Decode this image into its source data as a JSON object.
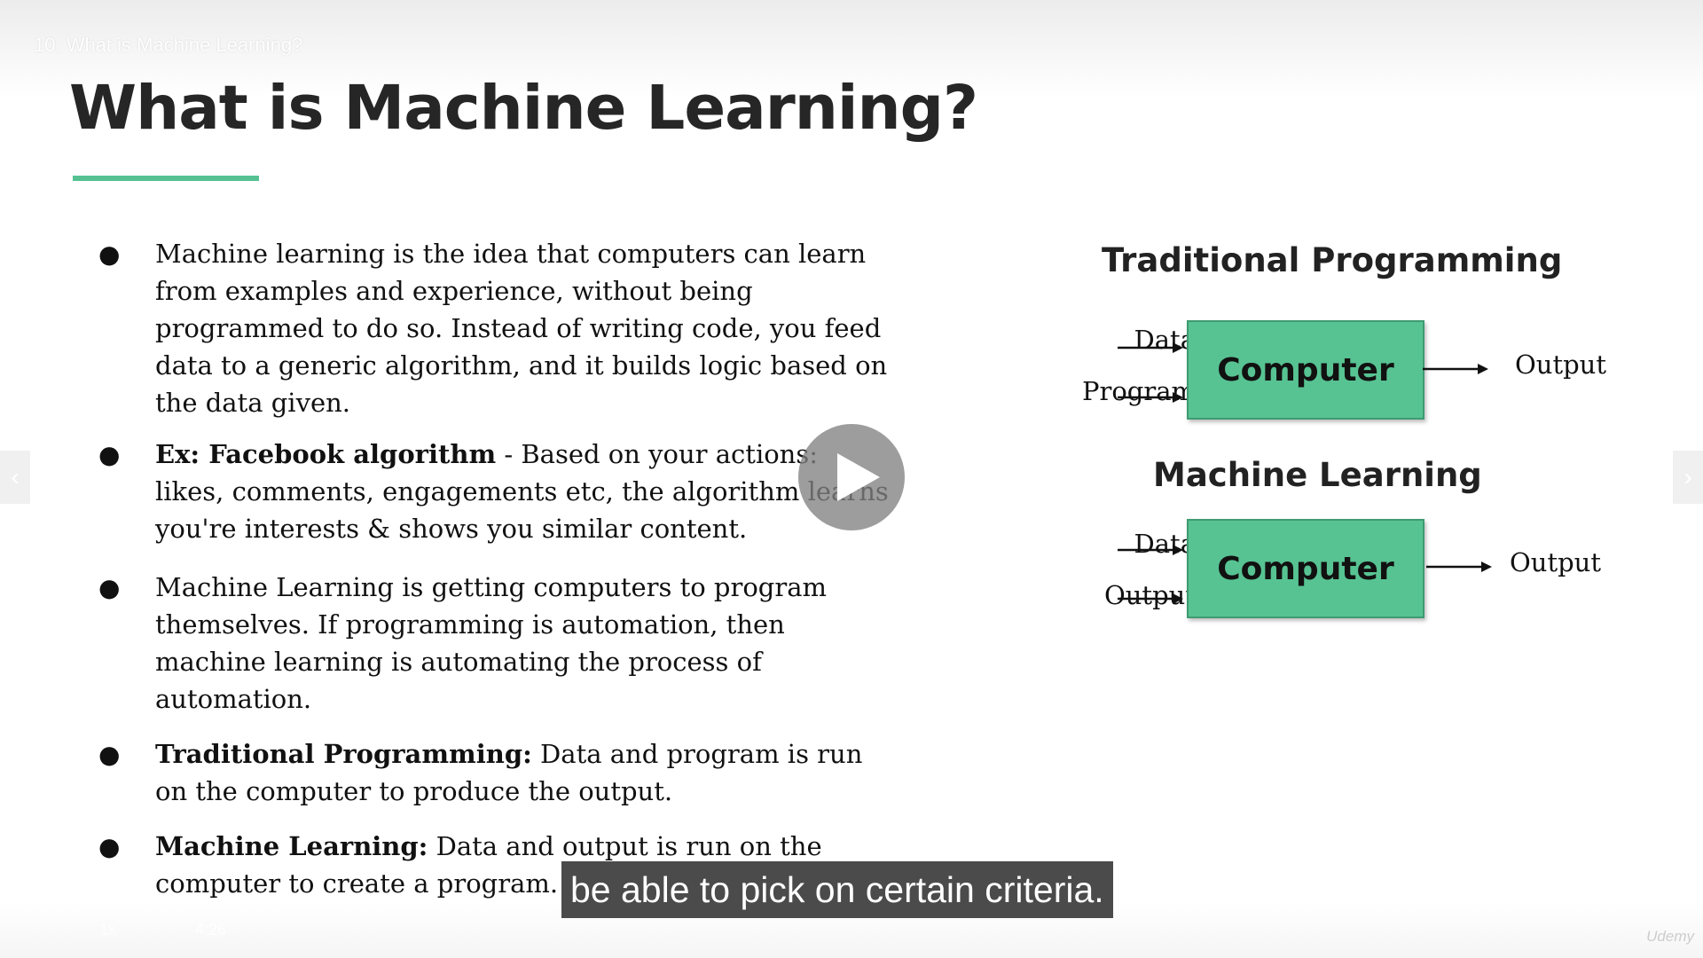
{
  "lecture": {
    "title": "10. What is Machine Learning?"
  },
  "slide": {
    "title": "What is Machine Learning?",
    "bullets": [
      {
        "bold": "",
        "text": "Machine learning is the idea that computers can learn from examples and experience, without being programmed to do so. Instead of writing code, you feed data to a generic algorithm, and it builds logic based on the data given."
      },
      {
        "bold": "Ex: Facebook algorithm",
        "text": " -  Based on your actions: likes, comments, engagements etc, the algorithm learns you're interests & shows you similar content."
      },
      {
        "bold": "",
        "text": "Machine Learning is getting computers to program themselves. If programming is automation, then machine learning is automating the process of automation."
      },
      {
        "bold": "Traditional Programming:",
        "text": " Data and program is run on the computer to produce the output."
      },
      {
        "bold": "Machine Learning:",
        "text": " Data and output is run on the computer to create a program."
      }
    ],
    "bullet_glyph": "●",
    "diagrams": {
      "traditional": {
        "title": "Traditional Programming",
        "input1": "Data",
        "input2": "Program",
        "box": "Computer",
        "output": "Output"
      },
      "ml": {
        "title": "Machine Learning",
        "input1": "Data",
        "input2": "Output",
        "box": "Computer",
        "output": "Output"
      }
    },
    "colors": {
      "accent": "#55c193",
      "box_fill": "#57c392",
      "title_text": "#262626"
    }
  },
  "player": {
    "caption": "be able to pick on certain criteria.",
    "play_icon": "play-icon",
    "prev_icon": "‹",
    "next_icon": "›",
    "time": "4:26",
    "speed": "1x",
    "watermark": "Udemy"
  }
}
